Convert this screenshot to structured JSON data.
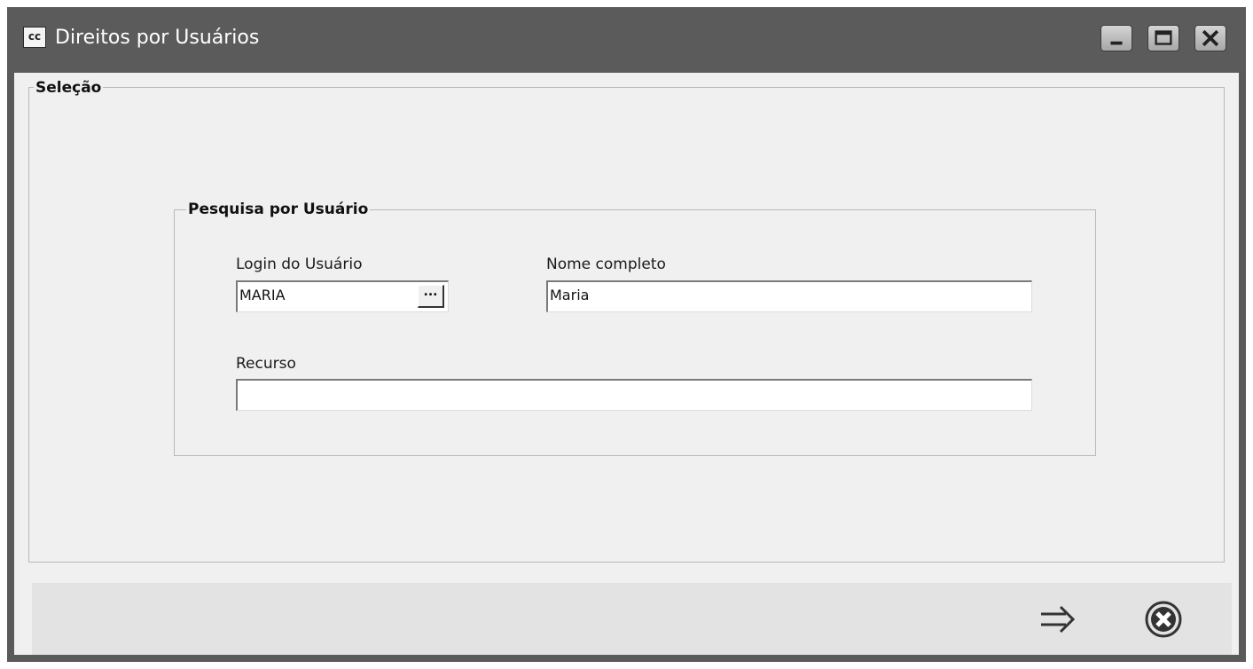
{
  "window": {
    "app_icon_text": "cc",
    "title": "Direitos por Usuários",
    "controls": [
      "minimize-icon",
      "maximize-icon",
      "close-icon"
    ]
  },
  "selecao": {
    "legend": "Seleção"
  },
  "pesquisa": {
    "legend": "Pesquisa por Usuário",
    "login": {
      "label": "Login do Usuário",
      "value": "MARIA",
      "lookup_label": "..."
    },
    "nome": {
      "label": "Nome completo",
      "value": "Maria"
    },
    "recurso": {
      "label": "Recurso",
      "value": ""
    }
  },
  "footer": {
    "next_icon": "arrow-right-icon",
    "close_icon": "cancel-circle-icon"
  }
}
